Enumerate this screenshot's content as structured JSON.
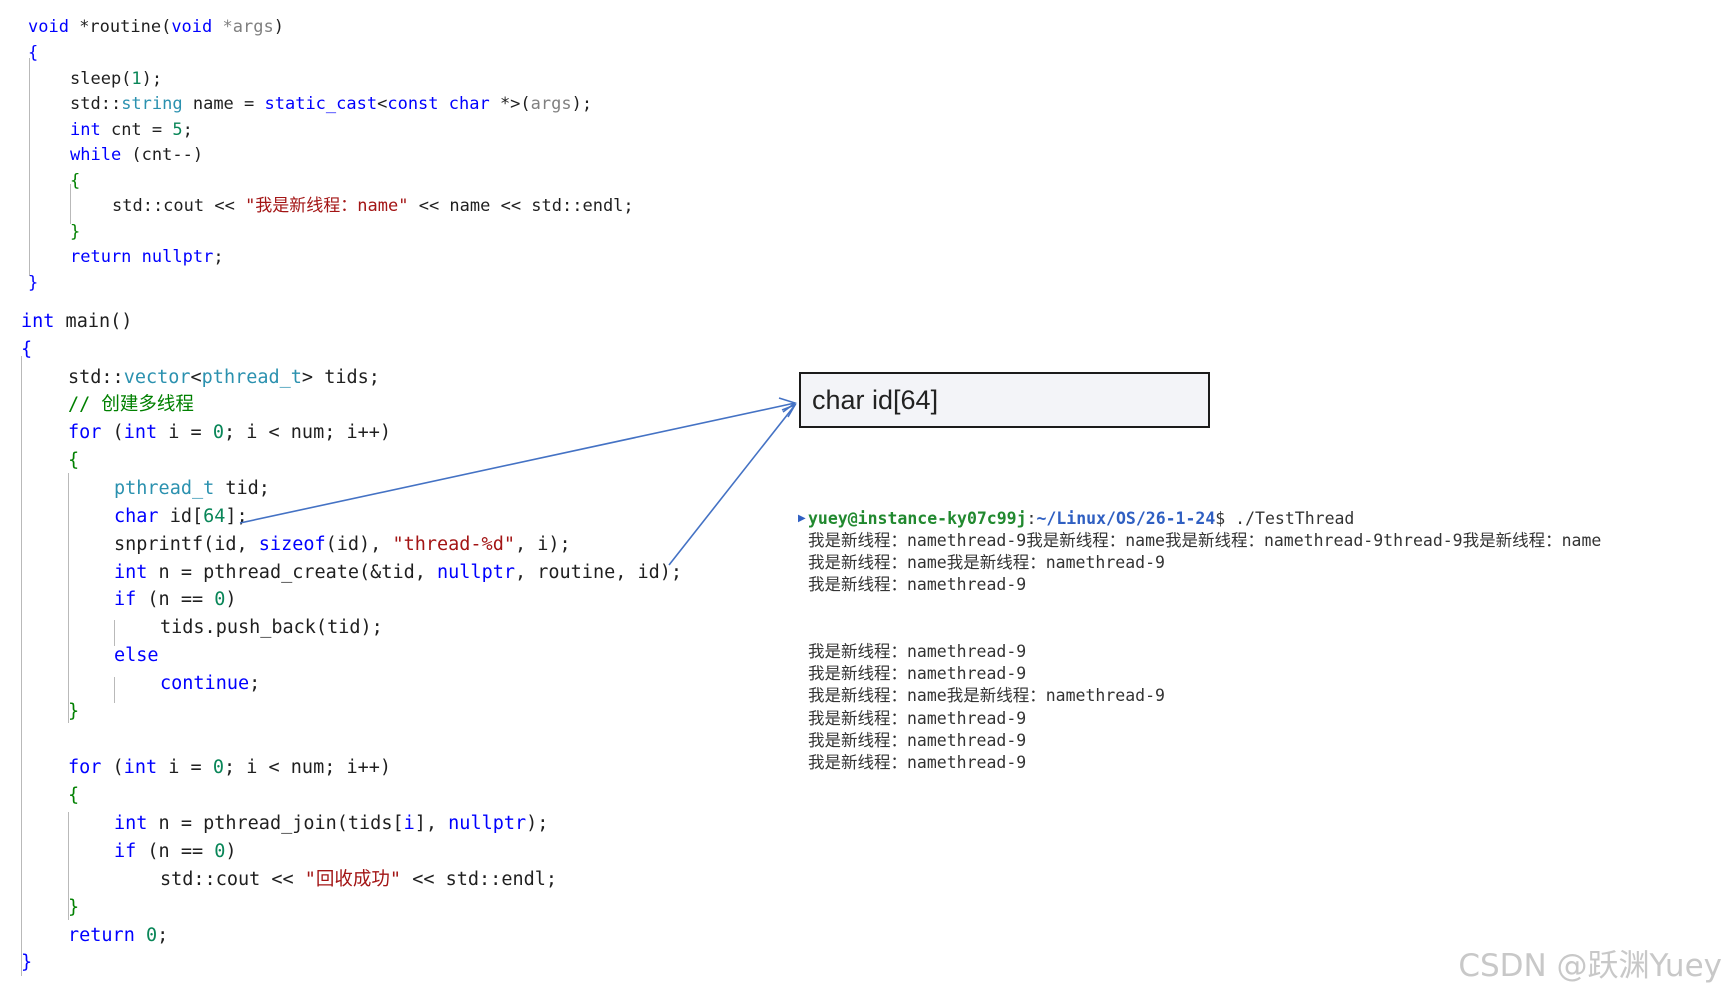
{
  "code": {
    "routine_header": "void *routine(void *args)",
    "routine_open": "{",
    "sleep_line": "sleep(1);",
    "string_line": "std::string name = static_cast<const char *>(args);",
    "cnt_line": "int cnt = 5;",
    "while_line": "while (cnt--)",
    "while_open": "{",
    "cout_line": "std::cout << \"我是新线程：name\" << name << std::endl;",
    "while_close": "}",
    "return_nullptr": "return nullptr;",
    "routine_close": "}",
    "main_header": "int main()",
    "main_open": "{",
    "vector_line": "std::vector<pthread_t> tids;",
    "comment_line": "// 创建多线程",
    "for1_line": "for (int i = 0; i < num; i++)",
    "for1_open": "{",
    "tid_line": "pthread_t tid;",
    "id_line": "char id[64];",
    "snprintf_line": "snprintf(id, sizeof(id), \"thread-%d\", i);",
    "create_line": "int n = pthread_create(&tid, nullptr, routine, id);",
    "if1_line": "if (n == 0)",
    "push_line": "tids.push_back(tid);",
    "else_line": "else",
    "continue_line": "continue;",
    "for1_close": "}",
    "for2_line": "for (int i = 0; i < num; i++)",
    "for2_open": "{",
    "join_line": "int n = pthread_join(tids[i], nullptr);",
    "if2_line": "if (n == 0)",
    "cout2_line": "std::cout << \"回收成功\" << std::endl;",
    "for2_close": "}",
    "return0_line": "return 0;",
    "main_close": "}"
  },
  "callout": {
    "text": "char id[64]"
  },
  "terminal": {
    "prompt_user": "yuey@instance-ky07c99j",
    "prompt_colon": ":",
    "prompt_path": "~/Linux/OS/26-1-24",
    "prompt_cmd": "$ ./TestThread",
    "lines": [
      "我是新线程：namethread-9我是新线程：name我是新线程：namethread-9thread-9我是新线程：name",
      "我是新线程：name我是新线程：namethread-9",
      "我是新线程：namethread-9",
      "",
      "",
      "我是新线程：namethread-9",
      "我是新线程：namethread-9",
      "我是新线程：name我是新线程：namethread-9",
      "我是新线程：namethread-9",
      "我是新线程：namethread-9",
      "我是新线程：namethread-9"
    ]
  },
  "watermark": "CSDN @跃渊Yuey",
  "colors": {
    "keyword": "#0000ff",
    "type": "#2b91af",
    "string": "#a31515",
    "comment": "#008000",
    "number": "#098658",
    "arrow": "#4472c4",
    "prompt_user": "#21892f",
    "prompt_path": "#2f5fc2"
  }
}
